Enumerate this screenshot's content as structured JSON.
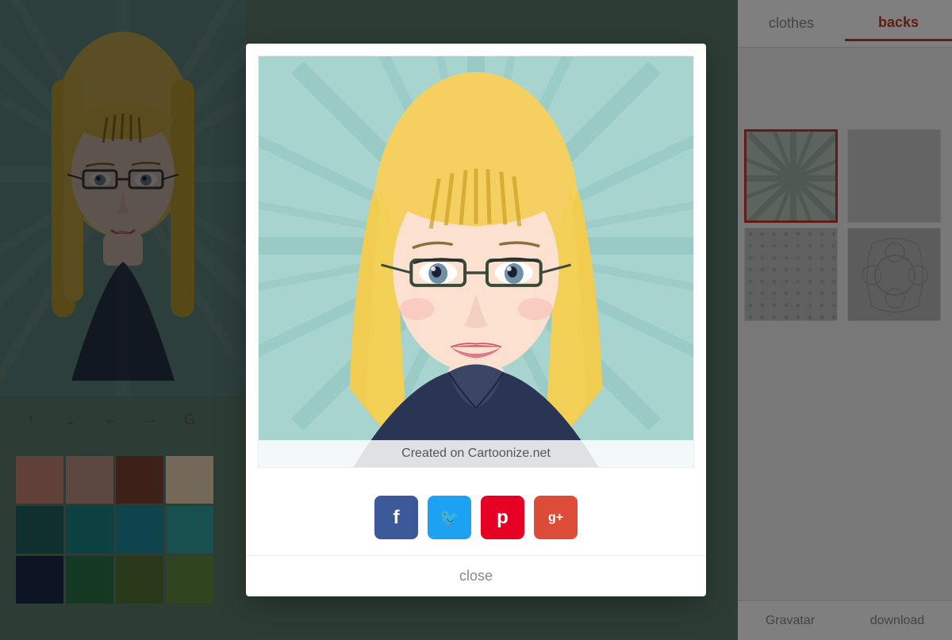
{
  "tabs": {
    "clothes_label": "clothes",
    "backs_label": "backs"
  },
  "bottom_bar": {
    "gravatar_label": "Gravatar",
    "download_label": "download"
  },
  "nav": {
    "up": "↑",
    "down": "↓",
    "back": "←",
    "forward": "→",
    "other": "G"
  },
  "swatches": {
    "colors": [
      "#c08070",
      "#b89080",
      "#7a4030",
      "#e8d0b0",
      "#206060",
      "#1a8080",
      "#208898",
      "#30a0a0",
      "#1a2848",
      "#287048",
      "#507030",
      "#608840"
    ]
  },
  "modal": {
    "watermark": "Created on Cartoonize.net",
    "close_label": "close",
    "social": {
      "facebook_label": "f",
      "twitter_label": "t",
      "pinterest_label": "p",
      "gplus_label": "g+"
    }
  },
  "backs_items": [
    {
      "id": "sunburst",
      "selected": true
    },
    {
      "id": "plain",
      "selected": false
    },
    {
      "id": "dots",
      "selected": false
    },
    {
      "id": "floral",
      "selected": false
    }
  ],
  "colors": {
    "active_tab": "#c0392b",
    "inactive_tab": "#888888"
  }
}
